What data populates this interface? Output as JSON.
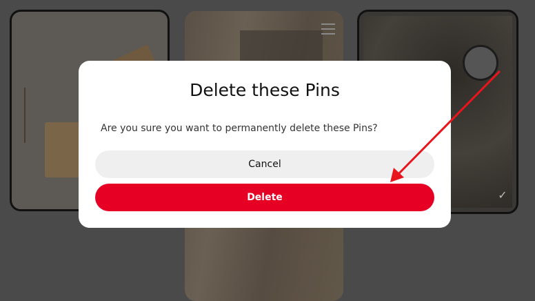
{
  "modal": {
    "title": "Delete these Pins",
    "message": "Are you sure you want to permanently delete these Pins?",
    "cancel_label": "Cancel",
    "delete_label": "Delete"
  },
  "colors": {
    "delete_red": "#e60023",
    "cancel_gray": "#efefef",
    "annotation_arrow": "#e8151c"
  },
  "pins": [
    {
      "name": "pin-gift-box",
      "selected": true
    },
    {
      "name": "pin-wood-desk",
      "selected": false
    },
    {
      "name": "pin-watch-flatlay",
      "selected": true
    }
  ]
}
